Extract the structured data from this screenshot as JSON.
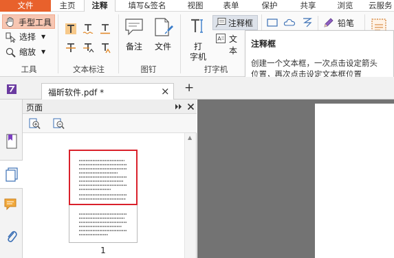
{
  "menu": {
    "tabs": [
      "文件",
      "主页",
      "注释",
      "填写&签名",
      "视图",
      "表单",
      "保护",
      "共享",
      "浏览",
      "云服务"
    ],
    "active_tab": "注释"
  },
  "ribbon": {
    "tools_group": {
      "hand_tool": "手型工具",
      "select": "选择",
      "zoom": "缩放",
      "label": "工具"
    },
    "text_markup_group": {
      "label": "文本标注"
    },
    "pin_group": {
      "note": "备注",
      "file": "文件",
      "label": "图钉"
    },
    "typewriter_group": {
      "typewriter_line1": "打",
      "typewriter_line2": "字机",
      "note_box": "注释框",
      "text_box": "文本",
      "label": "打字机"
    },
    "drawing": {
      "pencil": "铅笔"
    }
  },
  "tooltip": {
    "title": "注释框",
    "line1": "创建一个文本框，一次点击设定箭头",
    "line2": "位置，再次点击设定文本框位置"
  },
  "tabs": {
    "doc_title": "福昕软件.pdf *",
    "close": "×",
    "add": "+"
  },
  "panel": {
    "title": "页面",
    "page_number": "1"
  },
  "colors": {
    "file_tab": "#e8612c",
    "hand_highlight": "#f7c6b2",
    "selection_border": "#d9202a",
    "doc_background": "#737373"
  }
}
